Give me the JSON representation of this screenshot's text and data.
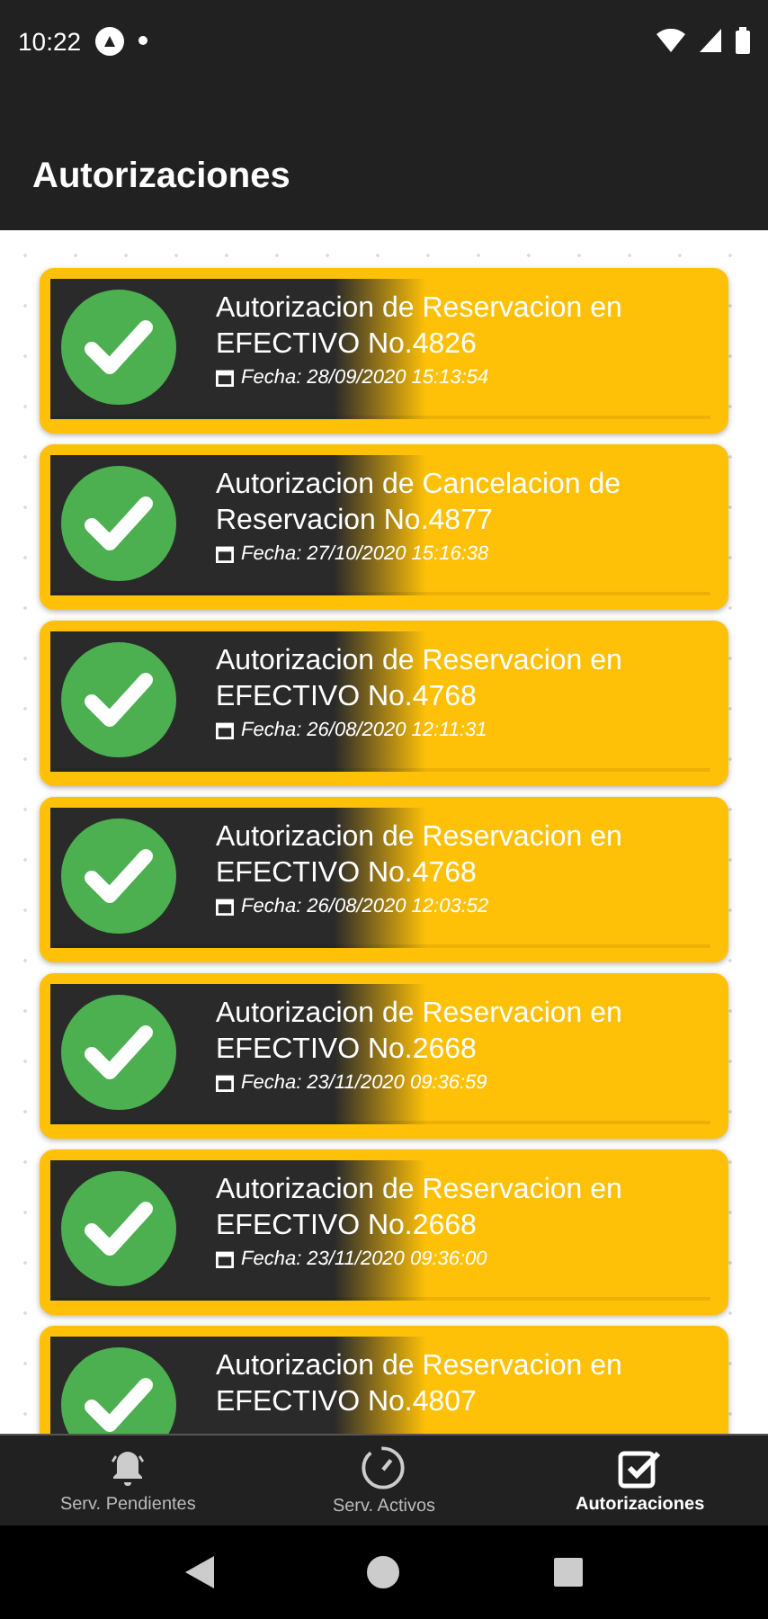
{
  "status_bar": {
    "time": "10:22"
  },
  "app_bar": {
    "title": "Autorizaciones"
  },
  "authorizations": [
    {
      "title": "Autorizacion de Reservacion en EFECTIVO No.4826",
      "date": "Fecha: 28/09/2020 15:13:54"
    },
    {
      "title": "Autorizacion de Cancelacion de Reservacion No.4877",
      "date": "Fecha: 27/10/2020 15:16:38"
    },
    {
      "title": "Autorizacion de Reservacion en EFECTIVO No.4768",
      "date": "Fecha: 26/08/2020 12:11:31"
    },
    {
      "title": "Autorizacion de Reservacion en EFECTIVO No.4768",
      "date": "Fecha: 26/08/2020 12:03:52"
    },
    {
      "title": "Autorizacion de Reservacion en EFECTIVO No.2668",
      "date": "Fecha: 23/11/2020 09:36:59"
    },
    {
      "title": "Autorizacion de Reservacion en EFECTIVO No.2668",
      "date": "Fecha: 23/11/2020 09:36:00"
    },
    {
      "title": "Autorizacion de Reservacion en EFECTIVO No.4807"
    }
  ],
  "bottom_nav": [
    {
      "kind": "bell",
      "label": "Serv. Pendientes",
      "selected": false
    },
    {
      "kind": "gauge",
      "label": "Serv. Activos",
      "selected": false
    },
    {
      "kind": "checkbox",
      "label": "Autorizaciones",
      "selected": true
    }
  ]
}
